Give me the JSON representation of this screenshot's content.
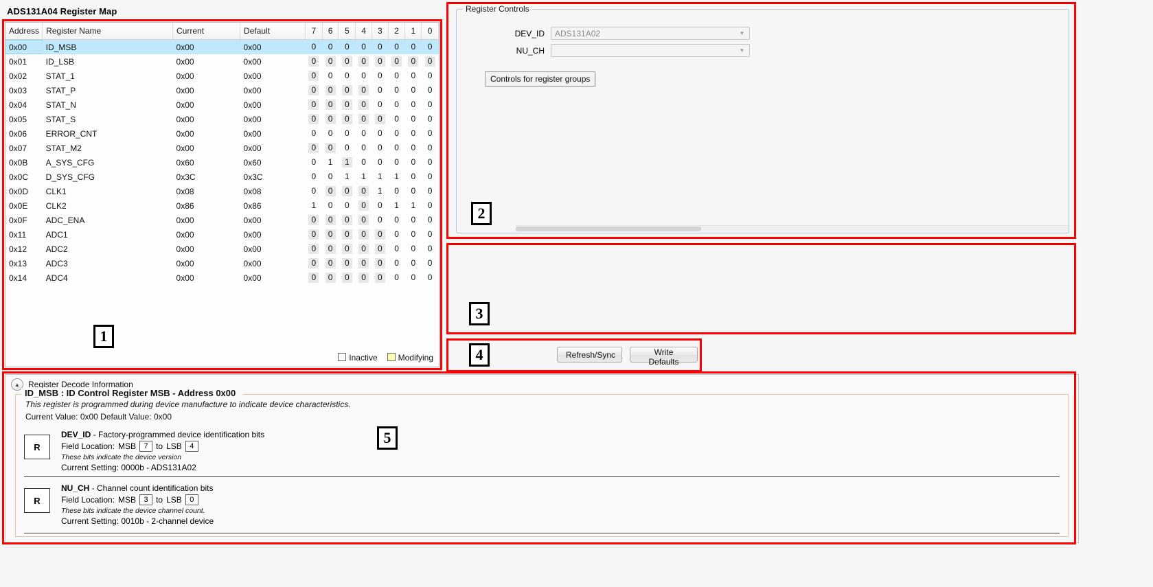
{
  "page": {
    "title": "ADS131A04 Register Map"
  },
  "register_map": {
    "columns": [
      "Address",
      "Register Name",
      "Current",
      "Default"
    ],
    "bit_columns": [
      "7",
      "6",
      "5",
      "4",
      "3",
      "2",
      "1",
      "0"
    ],
    "selected_row_index": 0,
    "rows": [
      {
        "address": "0x00",
        "name": "ID_MSB",
        "current": "0x00",
        "default": "0x00",
        "bits": [
          "0",
          "0",
          "0",
          "0",
          "0",
          "0",
          "0",
          "0"
        ],
        "inactive": [
          false,
          false,
          false,
          false,
          false,
          false,
          false,
          false
        ]
      },
      {
        "address": "0x01",
        "name": "ID_LSB",
        "current": "0x00",
        "default": "0x00",
        "bits": [
          "0",
          "0",
          "0",
          "0",
          "0",
          "0",
          "0",
          "0"
        ],
        "inactive": [
          true,
          true,
          true,
          true,
          true,
          true,
          true,
          true
        ]
      },
      {
        "address": "0x02",
        "name": "STAT_1",
        "current": "0x00",
        "default": "0x00",
        "bits": [
          "0",
          "0",
          "0",
          "0",
          "0",
          "0",
          "0",
          "0"
        ],
        "inactive": [
          true,
          false,
          false,
          false,
          false,
          false,
          false,
          false
        ]
      },
      {
        "address": "0x03",
        "name": "STAT_P",
        "current": "0x00",
        "default": "0x00",
        "bits": [
          "0",
          "0",
          "0",
          "0",
          "0",
          "0",
          "0",
          "0"
        ],
        "inactive": [
          true,
          true,
          true,
          true,
          false,
          false,
          false,
          false
        ]
      },
      {
        "address": "0x04",
        "name": "STAT_N",
        "current": "0x00",
        "default": "0x00",
        "bits": [
          "0",
          "0",
          "0",
          "0",
          "0",
          "0",
          "0",
          "0"
        ],
        "inactive": [
          true,
          true,
          true,
          true,
          false,
          false,
          false,
          false
        ]
      },
      {
        "address": "0x05",
        "name": "STAT_S",
        "current": "0x00",
        "default": "0x00",
        "bits": [
          "0",
          "0",
          "0",
          "0",
          "0",
          "0",
          "0",
          "0"
        ],
        "inactive": [
          true,
          true,
          true,
          true,
          true,
          false,
          false,
          false
        ]
      },
      {
        "address": "0x06",
        "name": "ERROR_CNT",
        "current": "0x00",
        "default": "0x00",
        "bits": [
          "0",
          "0",
          "0",
          "0",
          "0",
          "0",
          "0",
          "0"
        ],
        "inactive": [
          false,
          false,
          false,
          false,
          false,
          false,
          false,
          false
        ]
      },
      {
        "address": "0x07",
        "name": "STAT_M2",
        "current": "0x00",
        "default": "0x00",
        "bits": [
          "0",
          "0",
          "0",
          "0",
          "0",
          "0",
          "0",
          "0"
        ],
        "inactive": [
          true,
          true,
          false,
          false,
          false,
          false,
          false,
          false
        ]
      },
      {
        "address": "0x0B",
        "name": "A_SYS_CFG",
        "current": "0x60",
        "default": "0x60",
        "bits": [
          "0",
          "1",
          "1",
          "0",
          "0",
          "0",
          "0",
          "0"
        ],
        "inactive": [
          false,
          false,
          true,
          false,
          false,
          false,
          false,
          false
        ]
      },
      {
        "address": "0x0C",
        "name": "D_SYS_CFG",
        "current": "0x3C",
        "default": "0x3C",
        "bits": [
          "0",
          "0",
          "1",
          "1",
          "1",
          "1",
          "0",
          "0"
        ],
        "inactive": [
          false,
          false,
          false,
          false,
          false,
          false,
          false,
          false
        ]
      },
      {
        "address": "0x0D",
        "name": "CLK1",
        "current": "0x08",
        "default": "0x08",
        "bits": [
          "0",
          "0",
          "0",
          "0",
          "1",
          "0",
          "0",
          "0"
        ],
        "inactive": [
          false,
          true,
          true,
          true,
          false,
          false,
          false,
          false
        ]
      },
      {
        "address": "0x0E",
        "name": "CLK2",
        "current": "0x86",
        "default": "0x86",
        "bits": [
          "1",
          "0",
          "0",
          "0",
          "0",
          "1",
          "1",
          "0"
        ],
        "inactive": [
          false,
          false,
          false,
          true,
          false,
          false,
          false,
          false
        ]
      },
      {
        "address": "0x0F",
        "name": "ADC_ENA",
        "current": "0x00",
        "default": "0x00",
        "bits": [
          "0",
          "0",
          "0",
          "0",
          "0",
          "0",
          "0",
          "0"
        ],
        "inactive": [
          true,
          true,
          true,
          true,
          false,
          false,
          false,
          false
        ]
      },
      {
        "address": "0x11",
        "name": "ADC1",
        "current": "0x00",
        "default": "0x00",
        "bits": [
          "0",
          "0",
          "0",
          "0",
          "0",
          "0",
          "0",
          "0"
        ],
        "inactive": [
          true,
          true,
          true,
          true,
          true,
          false,
          false,
          false
        ]
      },
      {
        "address": "0x12",
        "name": "ADC2",
        "current": "0x00",
        "default": "0x00",
        "bits": [
          "0",
          "0",
          "0",
          "0",
          "0",
          "0",
          "0",
          "0"
        ],
        "inactive": [
          true,
          true,
          true,
          true,
          true,
          false,
          false,
          false
        ]
      },
      {
        "address": "0x13",
        "name": "ADC3",
        "current": "0x00",
        "default": "0x00",
        "bits": [
          "0",
          "0",
          "0",
          "0",
          "0",
          "0",
          "0",
          "0"
        ],
        "inactive": [
          true,
          true,
          true,
          true,
          true,
          false,
          false,
          false
        ]
      },
      {
        "address": "0x14",
        "name": "ADC4",
        "current": "0x00",
        "default": "0x00",
        "bits": [
          "0",
          "0",
          "0",
          "0",
          "0",
          "0",
          "0",
          "0"
        ],
        "inactive": [
          true,
          true,
          true,
          true,
          true,
          false,
          false,
          false
        ]
      }
    ],
    "legend": {
      "inactive": "Inactive",
      "modifying": "Modifying"
    }
  },
  "register_controls": {
    "group_title": "Register Controls",
    "dev_id": {
      "label": "DEV_ID",
      "value": "ADS131A02"
    },
    "nu_ch": {
      "label": "NU_CH",
      "value": ""
    },
    "tooltip": "Controls for register groups"
  },
  "actions": {
    "refresh_sync": "Refresh/Sync",
    "write_defaults": "Write Defaults"
  },
  "decode": {
    "section_title": "Register Decode Information",
    "register_title": "ID_MSB : ID Control Register MSB - Address 0x00",
    "description": "This register is programmed during device manufacture to indicate device characteristics.",
    "values_line": "Current Value: 0x00   Default Value: 0x00",
    "fields": [
      {
        "access": "R",
        "name": "DEV_ID",
        "separator": "-",
        "description": "Factory-programmed device identification bits",
        "loc_prefix": "Field Location:",
        "msb_label": "MSB",
        "msb": "7",
        "to": "to",
        "lsb_label": "LSB",
        "lsb": "4",
        "note": "These bits indicate the device version",
        "current_setting": "Current Setting: 0000b  -  ADS131A02"
      },
      {
        "access": "R",
        "name": "NU_CH",
        "separator": "-",
        "description": "Channel count identification bits",
        "loc_prefix": "Field Location:",
        "msb_label": "MSB",
        "msb": "3",
        "to": "to",
        "lsb_label": "LSB",
        "lsb": "0",
        "note": "These bits indicate the device channel count.",
        "current_setting": "Current Setting: 0010b  -  2-channel device"
      }
    ]
  },
  "annotations": {
    "box1": "1",
    "box2": "2",
    "box3": "3",
    "box4": "4",
    "box5": "5"
  },
  "colors": {
    "annotation": "#ff0000",
    "selection": "#bfe8fb",
    "inactive_cell": "#e7e7e7",
    "modifying": "#ffffb0"
  }
}
